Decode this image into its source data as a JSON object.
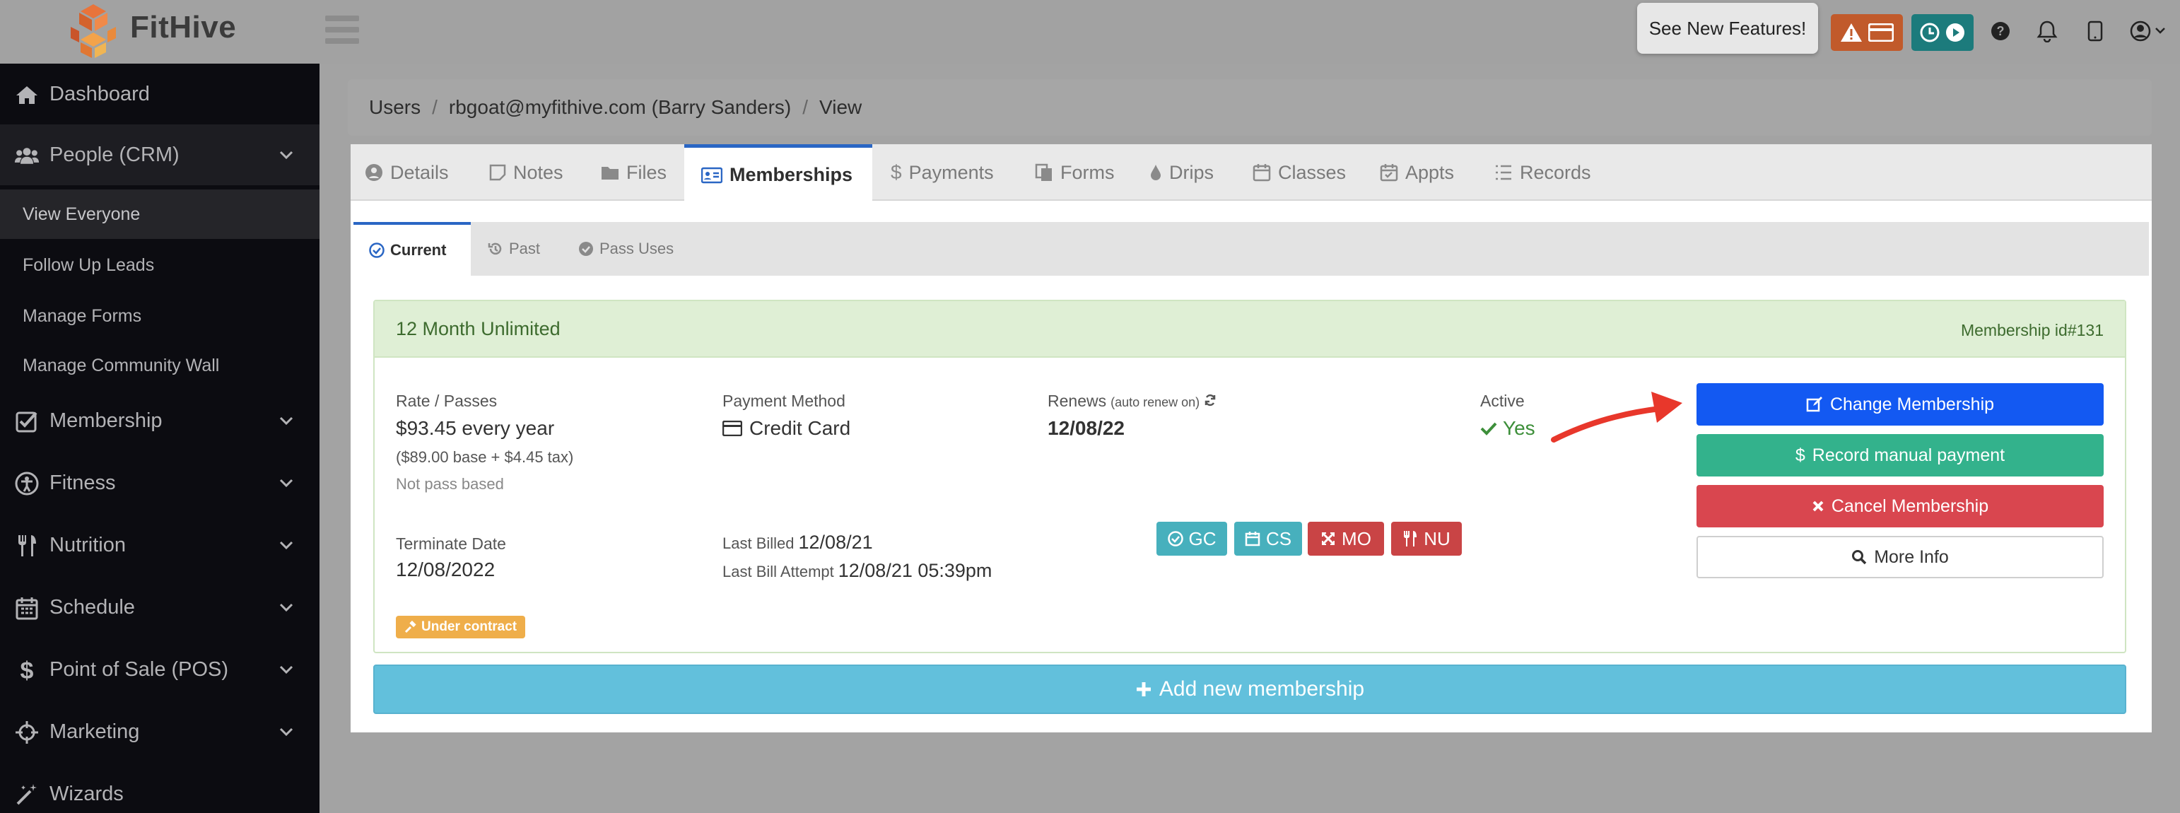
{
  "app": {
    "brand": "FitHive"
  },
  "topbar": {
    "see_new_features": "See New Features!"
  },
  "colors": {
    "sidebar_bg": "#0c0c11",
    "primary_blue": "#1359f2",
    "green": "#33b28c",
    "red": "#d9464f",
    "add_blue": "#62c0dc",
    "card_green": "#dfefd5",
    "warning_orange": "#efae4a",
    "annotation_arrow": "#e8372b"
  },
  "sidebar": {
    "items": [
      {
        "label": "Dashboard",
        "icon": "home-icon"
      },
      {
        "label": "People (CRM)",
        "icon": "users-icon"
      },
      {
        "label": "Membership",
        "icon": "checkbox-icon"
      },
      {
        "label": "Fitness",
        "icon": "accessibility-icon"
      },
      {
        "label": "Nutrition",
        "icon": "utensils-icon"
      },
      {
        "label": "Schedule",
        "icon": "calendar-icon"
      },
      {
        "label": "Point of Sale (POS)",
        "icon": "dollar-icon"
      },
      {
        "label": "Marketing",
        "icon": "crosshairs-icon"
      },
      {
        "label": "Wizards",
        "icon": "magic-wand-icon"
      }
    ],
    "sub_items": [
      "View Everyone",
      "Follow Up Leads",
      "Manage Forms",
      "Manage Community Wall"
    ]
  },
  "breadcrumb": {
    "items": [
      "Users",
      "rbgoat@myfithive.com (Barry Sanders)",
      "View"
    ],
    "separator": "/"
  },
  "tabs": [
    "Details",
    "Notes",
    "Files",
    "Memberships",
    "Payments",
    "Forms",
    "Drips",
    "Classes",
    "Appts",
    "Records"
  ],
  "subtabs": [
    "Current",
    "Past",
    "Pass Uses"
  ],
  "membership": {
    "title": "12 Month Unlimited",
    "id_label": "Membership id#131",
    "rate_label": "Rate / Passes",
    "rate_value": "$93.45 every year",
    "rate_breakdown": "($89.00 base + $4.45 tax)",
    "pass_note": "Not pass based",
    "payment_method_label": "Payment Method",
    "payment_method_value": "Credit Card",
    "renews_label": "Renews",
    "renews_note": "(auto renew on)",
    "renews_value": "12/08/22",
    "active_label": "Active",
    "active_value": "Yes",
    "terminate_label": "Terminate Date",
    "terminate_value": "12/08/2022",
    "last_billed_label": "Last Billed",
    "last_billed_value": "12/08/21",
    "last_attempt_label": "Last Bill Attempt",
    "last_attempt_value": "12/08/21 05:39pm",
    "badges": [
      "GC",
      "CS",
      "MO",
      "NU"
    ],
    "contract_badge": "Under contract"
  },
  "actions": {
    "change": "Change Membership",
    "record": "Record manual payment",
    "cancel": "Cancel Membership",
    "more": "More Info"
  },
  "add_membership": "Add new membership"
}
